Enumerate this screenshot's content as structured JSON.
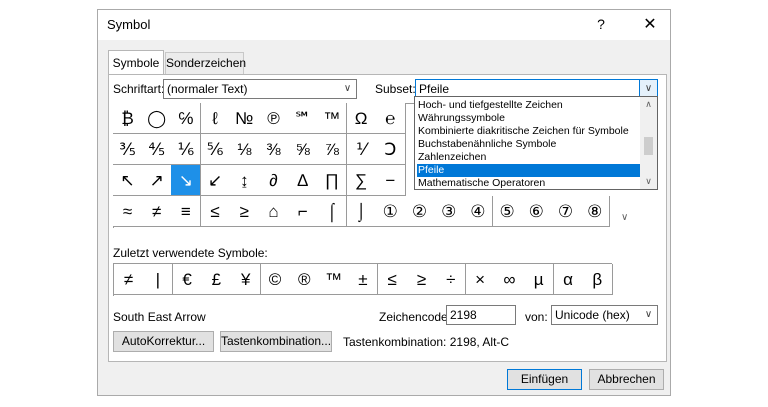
{
  "window": {
    "title": "Symbol",
    "help": "?",
    "close": "✕"
  },
  "tabs": [
    {
      "label": "Symbole",
      "active": true
    },
    {
      "label": "Sonderzeichen",
      "active": false
    }
  ],
  "font_label": "Schriftart:",
  "font_value": "(normaler Text)",
  "subset_label": "Subset:",
  "subset_value": "Pfeile",
  "subset_options": [
    {
      "label": "Hoch- und tiefgestellte Zeichen",
      "selected": false
    },
    {
      "label": "Währungssymbole",
      "selected": false
    },
    {
      "label": "Kombinierte diakritische Zeichen für Symbole",
      "selected": false
    },
    {
      "label": "Buchstabenähnliche Symbole",
      "selected": false
    },
    {
      "label": "Zahlenzeichen",
      "selected": false
    },
    {
      "label": "Pfeile",
      "selected": true
    },
    {
      "label": "Mathematische Operatoren",
      "selected": false
    }
  ],
  "symbol_rows": [
    [
      "₿",
      "◯",
      "℅",
      "ℓ",
      "№",
      "℗",
      "℠",
      "™",
      "Ω",
      "℮"
    ],
    [
      "⅗",
      "⅘",
      "⅙",
      "⅚",
      "⅛",
      "⅜",
      "⅝",
      "⅞",
      "⅟",
      "Ↄ"
    ],
    [
      "↖",
      "↗",
      "↘",
      "↙",
      "↨",
      "∂",
      "∆",
      "∏",
      "∑",
      "−"
    ],
    [
      "≈",
      "≠",
      "≡",
      "≤",
      "≥",
      "⌂",
      "⌐",
      "⌠",
      "⌡",
      "①",
      "②",
      "③",
      "④",
      "⑤",
      "⑥",
      "⑦",
      "⑧"
    ]
  ],
  "selected_symbol": "↘",
  "recent_label": "Zuletzt verwendete Symbole:",
  "recent_symbols": [
    "≠",
    "|",
    "€",
    "£",
    "¥",
    "©",
    "®",
    "™",
    "±",
    "≤",
    "≥",
    "÷",
    "×",
    "∞",
    "µ",
    "α",
    "β"
  ],
  "char_name": "South East Arrow",
  "code_label": "Zeichencode:",
  "code_value": "2198",
  "from_label": "von:",
  "from_value": "Unicode (hex)",
  "autocorrect_button": "AutoKorrektur...",
  "shortcut_button": "Tastenkombination...",
  "shortcut_text": "Tastenkombination: 2198, Alt-C",
  "insert_button": "Einfügen",
  "cancel_button": "Abbrechen"
}
